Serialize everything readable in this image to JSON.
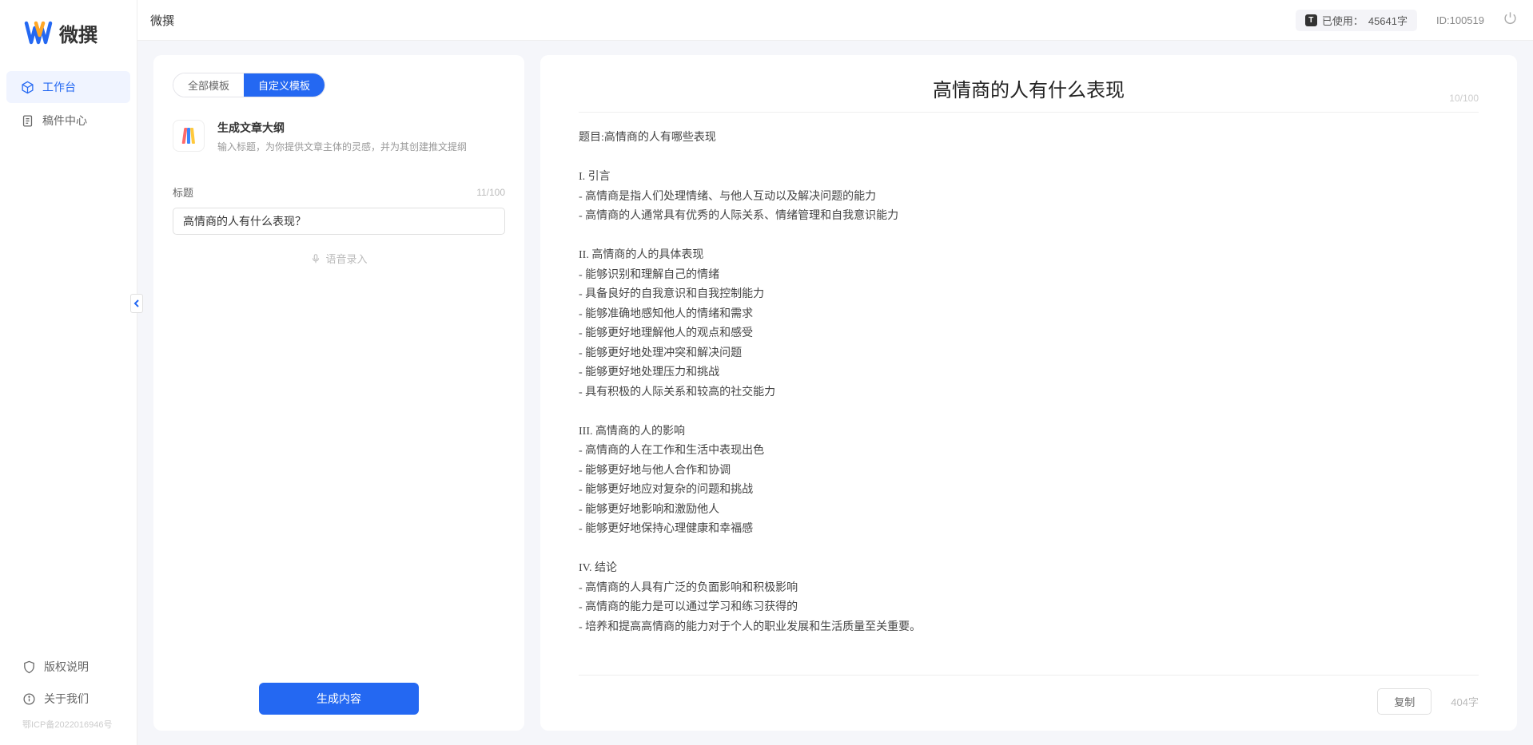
{
  "app": {
    "logo_text": "微撰",
    "title": "微撰"
  },
  "sidebar": {
    "items": [
      {
        "label": "工作台",
        "icon": "cube-icon",
        "active": true
      },
      {
        "label": "稿件中心",
        "icon": "document-icon",
        "active": false
      }
    ],
    "footer_items": [
      {
        "label": "版权说明",
        "icon": "shield-icon"
      },
      {
        "label": "关于我们",
        "icon": "info-icon"
      }
    ],
    "icp": "鄂ICP备2022016946号"
  },
  "topbar": {
    "usage_prefix": "已使用：",
    "usage_value": "45641字",
    "id_label": "ID:100519"
  },
  "left_panel": {
    "tabs": [
      {
        "label": "全部模板",
        "active": false
      },
      {
        "label": "自定义模板",
        "active": true
      }
    ],
    "template": {
      "title": "生成文章大纲",
      "desc": "输入标题，为你提供文章主体的灵感，并为其创建推文提纲"
    },
    "title_field": {
      "label": "标题",
      "counter": "11/100",
      "value": "高情商的人有什么表现？"
    },
    "voice_input_label": "语音录入",
    "generate_label": "生成内容"
  },
  "output": {
    "title": "高情商的人有什么表现",
    "title_counter": "10/100",
    "body": "题目:高情商的人有哪些表现\n\nI. 引言\n- 高情商是指人们处理情绪、与他人互动以及解决问题的能力\n- 高情商的人通常具有优秀的人际关系、情绪管理和自我意识能力\n\nII. 高情商的人的具体表现\n- 能够识别和理解自己的情绪\n- 具备良好的自我意识和自我控制能力\n- 能够准确地感知他人的情绪和需求\n- 能够更好地理解他人的观点和感受\n- 能够更好地处理冲突和解决问题\n- 能够更好地处理压力和挑战\n- 具有积极的人际关系和较高的社交能力\n\nIII. 高情商的人的影响\n- 高情商的人在工作和生活中表现出色\n- 能够更好地与他人合作和协调\n- 能够更好地应对复杂的问题和挑战\n- 能够更好地影响和激励他人\n- 能够更好地保持心理健康和幸福感\n\nIV. 结论\n- 高情商的人具有广泛的负面影响和积极影响\n- 高情商的能力是可以通过学习和练习获得的\n- 培养和提高高情商的能力对于个人的职业发展和生活质量至关重要。",
    "copy_label": "复制",
    "char_count": "404字"
  }
}
